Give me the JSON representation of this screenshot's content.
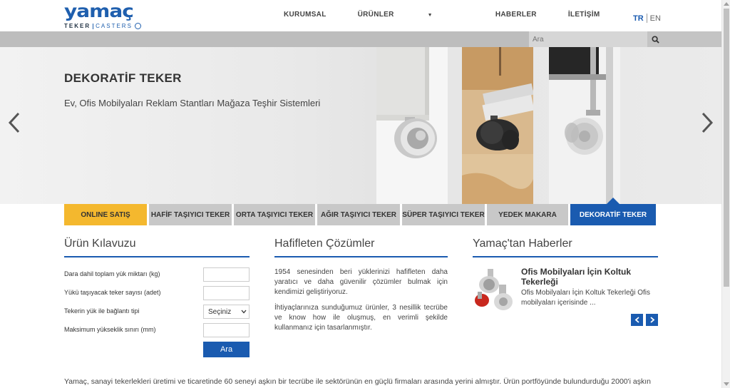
{
  "header": {
    "logo_text": "yamaç",
    "logo_teker": "TEKER",
    "logo_casters": "CASTERS",
    "nav": [
      {
        "label": "KURUMSAL"
      },
      {
        "label": "ÜRÜNLER"
      },
      {
        "label": "HABERLER"
      },
      {
        "label": "İLETİŞİM"
      }
    ],
    "lang_tr": "TR",
    "lang_en": "EN"
  },
  "search": {
    "placeholder": "Ara"
  },
  "hero": {
    "title": "DEKORATİF TEKER",
    "subtitle": "Ev, Ofis Mobilyaları Reklam Stantları Mağaza Teşhir Sistemleri"
  },
  "tabs": [
    {
      "label": "ONLINE SATIŞ"
    },
    {
      "label": "HAFİF TAŞIYICI TEKER"
    },
    {
      "label": "ORTA TAŞIYICI TEKER"
    },
    {
      "label": "AĞIR TAŞIYICI TEKER"
    },
    {
      "label": "SÜPER TAŞIYICI TEKER"
    },
    {
      "label": "YEDEK MAKARA"
    },
    {
      "label": "DEKORATİF TEKER"
    }
  ],
  "guide": {
    "title": "Ürün Kılavuzu",
    "fields": [
      {
        "label": "Dara dahil toplam yük miktarı (kg)",
        "value": ""
      },
      {
        "label": "Yükü taşıyacak teker sayısı (adet)",
        "value": ""
      },
      {
        "label": "Tekerin yük ile bağlantı tipi",
        "value": "Seçiniz"
      },
      {
        "label": "Maksimum yükseklik sınırı (mm)",
        "value": ""
      }
    ],
    "button": "Ara"
  },
  "solutions": {
    "title": "Hafifleten Çözümler",
    "p1": "1954 senesinden beri yüklerinizi hafifleten daha yaratıcı ve daha güvenilir çözümler bulmak için kendimizi geliştiriyoruz.",
    "p2": "İhtiyaçlarınıza sunduğumuz ürünler, 3 nesillik tecrübe ve know how ile oluşmuş, en verimli şekilde kullanmanız için tasarlanmıştır."
  },
  "news": {
    "title": "Yamaç'tan Haberler",
    "item_title": "Ofis Mobilyaları İçin Koltuk Tekerleği",
    "item_text": "Ofis Mobilyaları İçin Koltuk Tekerleği Ofis mobilyaları içerisinde ..."
  },
  "footer_text": "Yamaç, sanayi tekerlekleri üretimi ve ticaretinde 60 seneyi aşkın bir tecrübe ile sektörünün en güçlü firmaları arasında yerini almıştır. Ürün portföyünde bulundurduğu 2000'i aşkın",
  "colors": {
    "brand": "#1a5bb0",
    "online": "#f4b82e",
    "tab": "#c8c8c8"
  }
}
